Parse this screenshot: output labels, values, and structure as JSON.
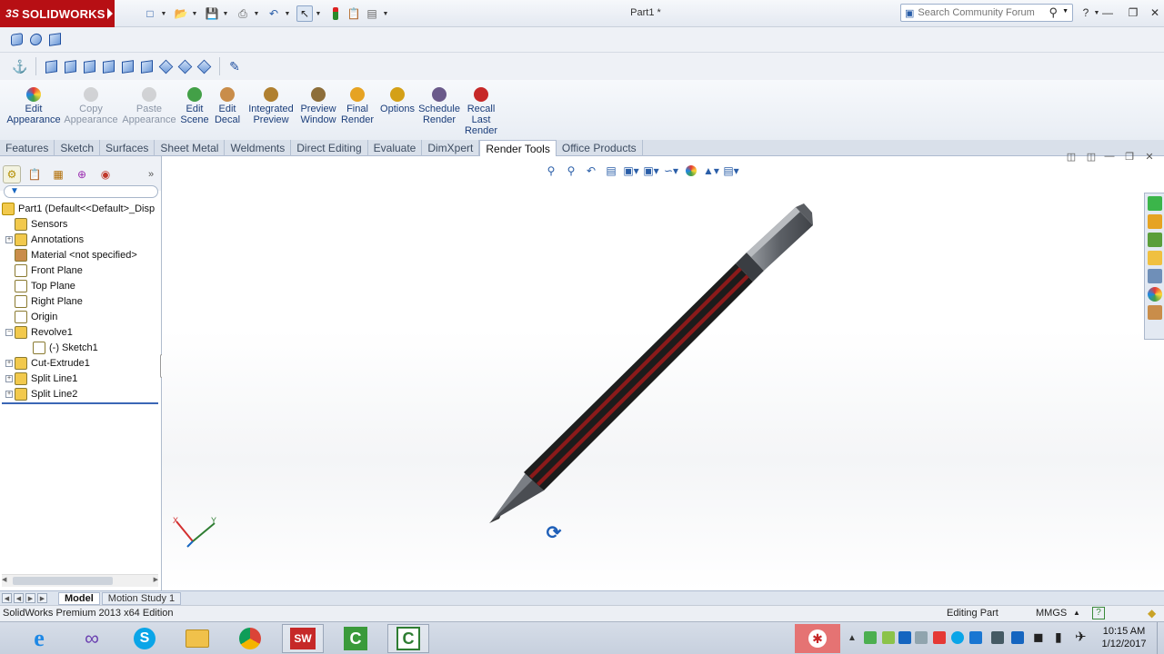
{
  "app": {
    "brand": "SOLIDWORKS",
    "brand_mark": "3S",
    "document_title": "Part1 *",
    "search_placeholder": "Search Community Forum"
  },
  "ribbon": {
    "buttons": [
      {
        "label": "Edit\nAppearance",
        "icon": "appearance-ball-icon",
        "enabled": true
      },
      {
        "label": "Copy\nAppearance",
        "icon": "copy-appearance-icon",
        "enabled": false
      },
      {
        "label": "Paste\nAppearance",
        "icon": "paste-appearance-icon",
        "enabled": false
      },
      {
        "label": "Edit\nScene",
        "icon": "scene-icon",
        "enabled": true
      },
      {
        "label": "Edit\nDecal",
        "icon": "decal-icon",
        "enabled": true
      },
      {
        "label": "Integrated\nPreview",
        "icon": "integrated-preview-icon",
        "enabled": true
      },
      {
        "label": "Preview\nWindow",
        "icon": "preview-window-icon",
        "enabled": true
      },
      {
        "label": "Final\nRender",
        "icon": "final-render-icon",
        "enabled": true
      },
      {
        "label": "Options",
        "icon": "options-icon",
        "enabled": true
      },
      {
        "label": "Schedule\nRender",
        "icon": "schedule-render-icon",
        "enabled": true
      },
      {
        "label": "Recall\nLast\nRender",
        "icon": "recall-render-icon",
        "enabled": true
      }
    ]
  },
  "tabs": [
    "Features",
    "Sketch",
    "Surfaces",
    "Sheet Metal",
    "Weldments",
    "Direct Editing",
    "Evaluate",
    "DimXpert",
    "Render Tools",
    "Office Products"
  ],
  "active_tab": "Render Tools",
  "feature_tree": {
    "root": "Part1  (Default<<Default>_Disp",
    "items": [
      {
        "label": "Sensors",
        "icon": "sensors-icon",
        "expandable": false,
        "indent": 1
      },
      {
        "label": "Annotations",
        "icon": "annotations-icon",
        "expandable": true,
        "indent": 1
      },
      {
        "label": "Material <not specified>",
        "icon": "material-icon",
        "expandable": false,
        "indent": 1
      },
      {
        "label": "Front Plane",
        "icon": "plane-icon",
        "expandable": false,
        "indent": 1
      },
      {
        "label": "Top Plane",
        "icon": "plane-icon",
        "expandable": false,
        "indent": 1
      },
      {
        "label": "Right Plane",
        "icon": "plane-icon",
        "expandable": false,
        "indent": 1
      },
      {
        "label": "Origin",
        "icon": "origin-icon",
        "expandable": false,
        "indent": 1
      },
      {
        "label": "Revolve1",
        "icon": "revolve-icon",
        "expandable": true,
        "indent": 1
      },
      {
        "label": "(-) Sketch1",
        "icon": "sketch-icon",
        "expandable": false,
        "indent": 2
      },
      {
        "label": "Cut-Extrude1",
        "icon": "cut-extrude-icon",
        "expandable": true,
        "indent": 1
      },
      {
        "label": "Split Line1",
        "icon": "split-line-icon",
        "expandable": true,
        "indent": 1
      },
      {
        "label": "Split Line2",
        "icon": "split-line-icon",
        "expandable": true,
        "indent": 1
      }
    ]
  },
  "bottom_tabs": [
    "Model",
    "Motion Study 1"
  ],
  "status": {
    "edition": "SolidWorks Premium 2013 x64 Edition",
    "mode": "Editing Part",
    "units": "MMGS"
  },
  "triad": {
    "x": "X",
    "y": "Y"
  },
  "clock": {
    "time": "10:15 AM",
    "date": "1/12/2017"
  },
  "colors": {
    "brand_red": "#b70f14",
    "pencil_body": "#1b1b1b",
    "pencil_stripe": "#8b1a1a",
    "ferrule": "#6f7378"
  }
}
